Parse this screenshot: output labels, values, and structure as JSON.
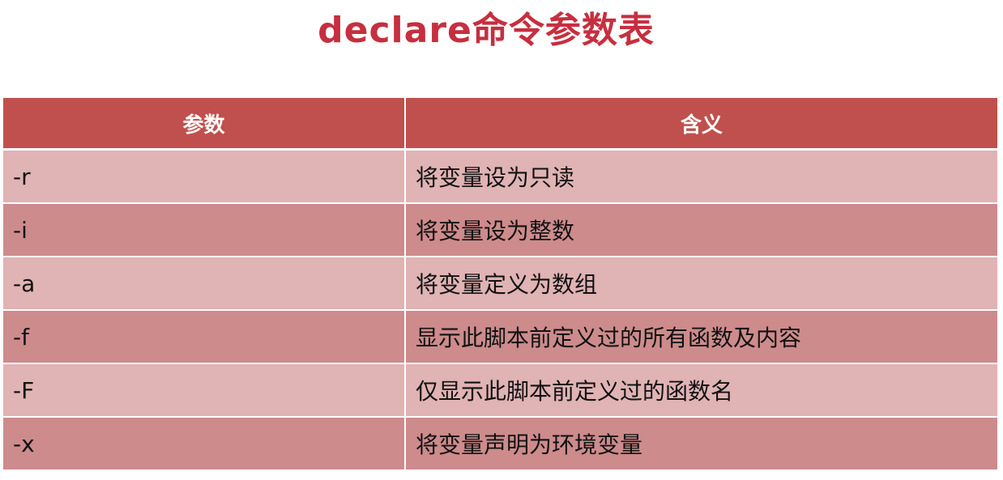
{
  "title": "declare命令参数表",
  "table": {
    "headers": [
      "参数",
      "含义"
    ],
    "rows": [
      [
        "-r",
        "将变量设为只读"
      ],
      [
        "-i",
        "将变量设为整数"
      ],
      [
        "-a",
        "将变量定义为数组"
      ],
      [
        "-f",
        "显示此脚本前定义过的所有函数及内容"
      ],
      [
        "-F",
        "仅显示此脚本前定义过的函数名"
      ],
      [
        "-x",
        "将变量声明为环境变量"
      ]
    ]
  },
  "colors": {
    "title": "#c62f3f",
    "header_bg": "#c0504d",
    "row_light": "#e0b3b4",
    "row_dark": "#cd8b8c"
  }
}
